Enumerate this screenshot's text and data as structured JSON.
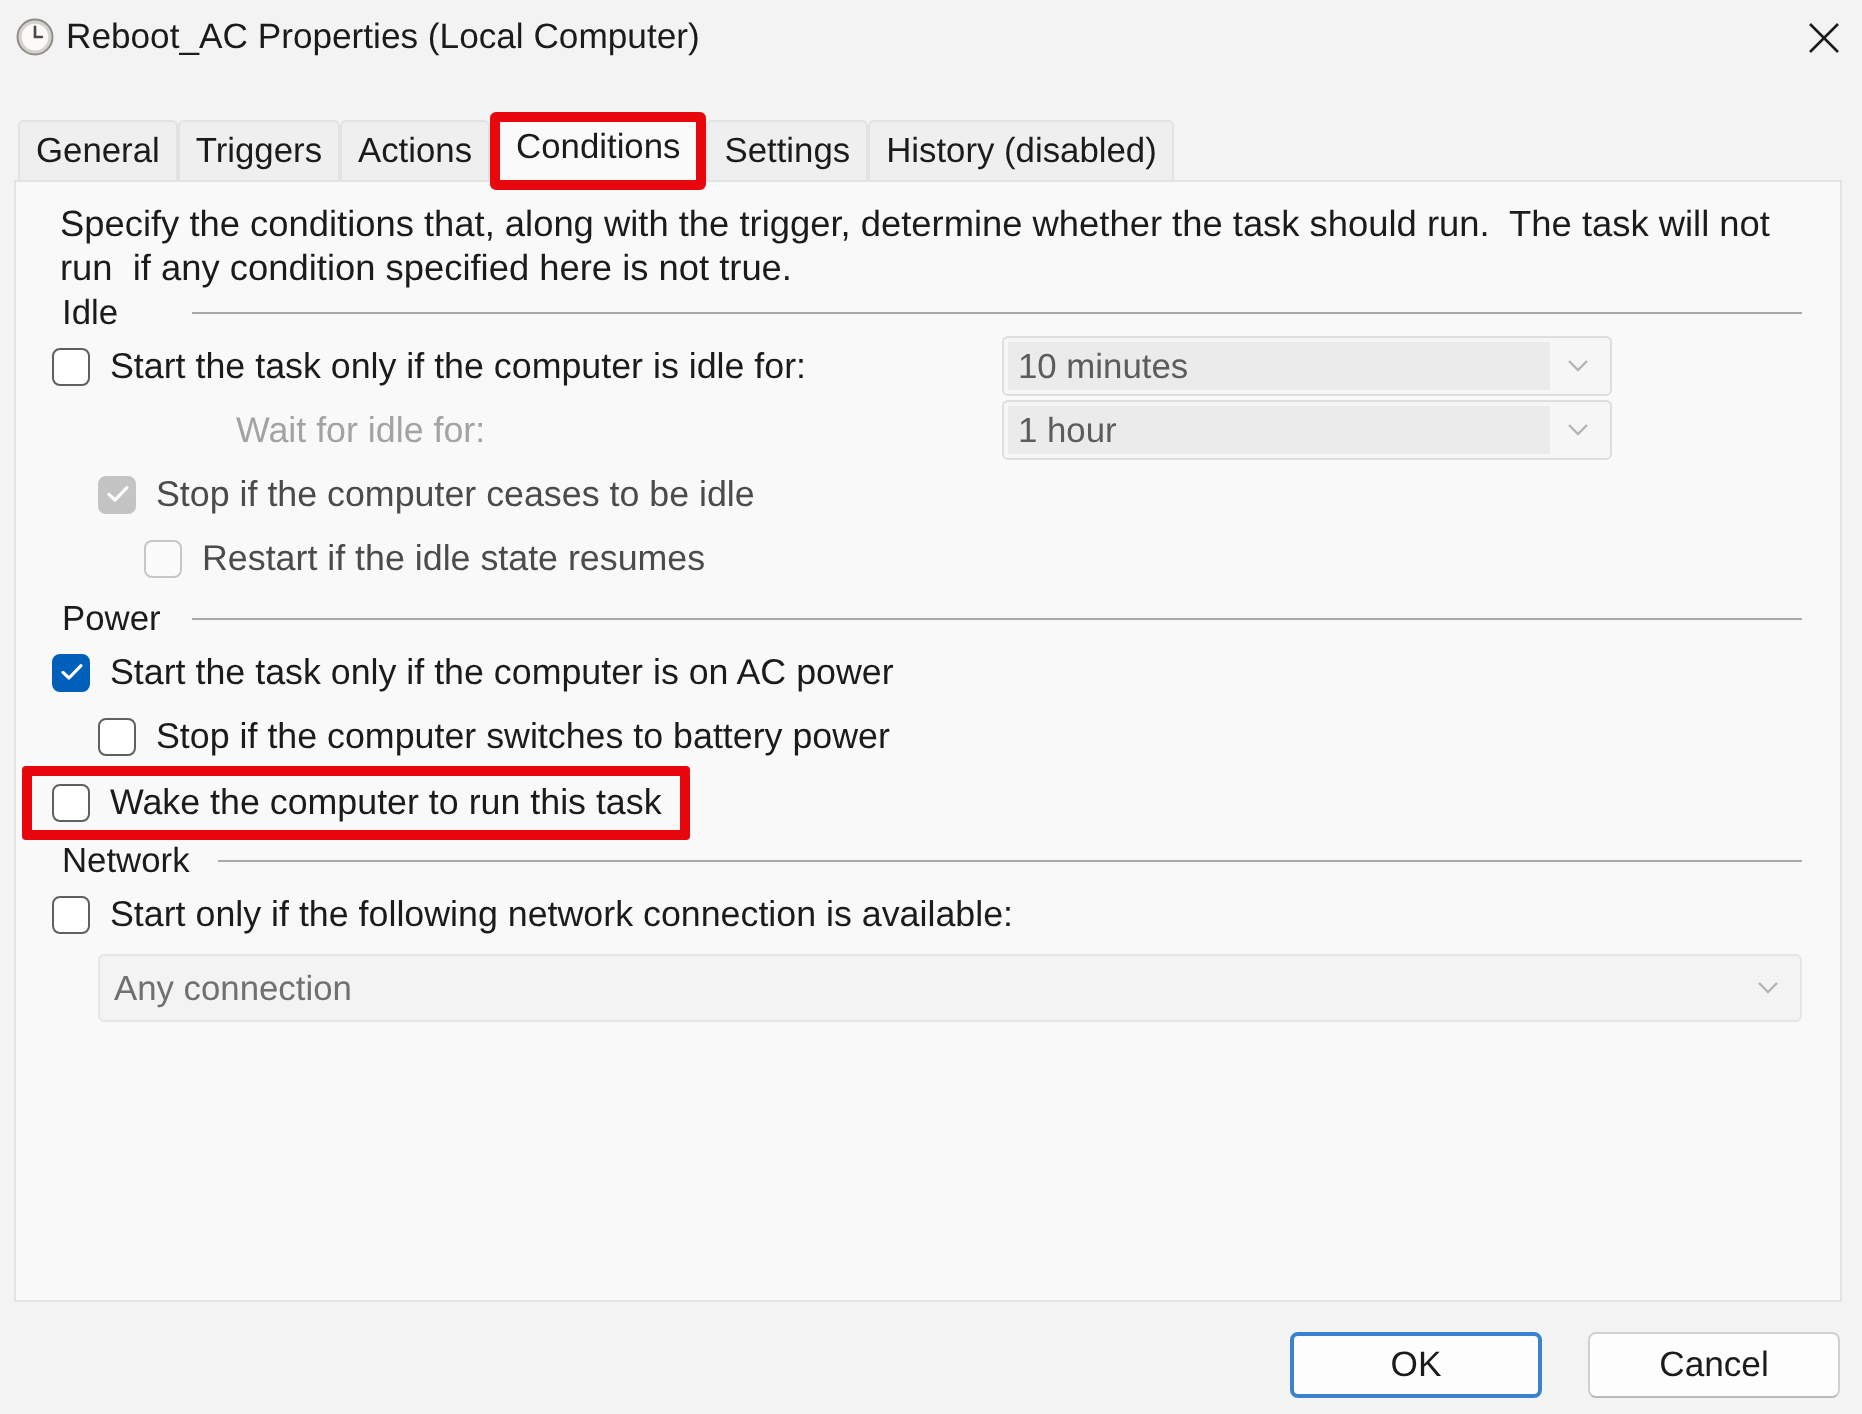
{
  "window": {
    "title": "Reboot_AC Properties (Local Computer)"
  },
  "tabs": [
    {
      "label": "General",
      "selected": false,
      "highlighted": false
    },
    {
      "label": "Triggers",
      "selected": false,
      "highlighted": false
    },
    {
      "label": "Actions",
      "selected": false,
      "highlighted": false
    },
    {
      "label": "Conditions",
      "selected": true,
      "highlighted": true
    },
    {
      "label": "Settings",
      "selected": false,
      "highlighted": false
    },
    {
      "label": "History (disabled)",
      "selected": false,
      "highlighted": false
    }
  ],
  "description": "Specify the conditions that, along with the trigger, determine whether the task should run.  The task will not run  if any condition specified here is not true.",
  "groups": [
    {
      "title": "Idle",
      "items": [
        {
          "kind": "checkbox",
          "label": "Start the task only if the computer is idle for:",
          "checked": false,
          "disabled": false,
          "highlighted": false,
          "dropdown": {
            "value": "10 minutes",
            "disabled": true
          },
          "children": [
            {
              "kind": "label",
              "label": "Wait for idle for:",
              "disabled": true,
              "dropdown": {
                "value": "1 hour",
                "disabled": true
              }
            },
            {
              "kind": "checkbox",
              "label": "Stop if the computer ceases to be idle",
              "checked": true,
              "disabled": true,
              "highlighted": false,
              "children": [
                {
                  "kind": "checkbox",
                  "label": "Restart if the idle state resumes",
                  "checked": false,
                  "disabled": true,
                  "highlighted": false
                }
              ]
            }
          ]
        }
      ]
    },
    {
      "title": "Power",
      "items": [
        {
          "kind": "checkbox",
          "label": "Start the task only if the computer is on AC power",
          "checked": true,
          "disabled": false,
          "highlighted": false,
          "children": [
            {
              "kind": "checkbox",
              "label": "Stop if the computer switches to battery power",
              "checked": false,
              "disabled": false,
              "highlighted": false
            }
          ]
        },
        {
          "kind": "checkbox",
          "label": "Wake the computer to run this task",
          "checked": false,
          "disabled": false,
          "highlighted": true
        }
      ]
    },
    {
      "title": "Network",
      "items": [
        {
          "kind": "checkbox",
          "label": "Start only if the following network connection is available:",
          "checked": false,
          "disabled": false,
          "highlighted": false,
          "children": [
            {
              "kind": "dropdown",
              "value": "Any connection",
              "disabled": true
            }
          ]
        }
      ]
    }
  ],
  "buttons": [
    {
      "label": "OK",
      "default": true
    },
    {
      "label": "Cancel",
      "default": false
    }
  ]
}
